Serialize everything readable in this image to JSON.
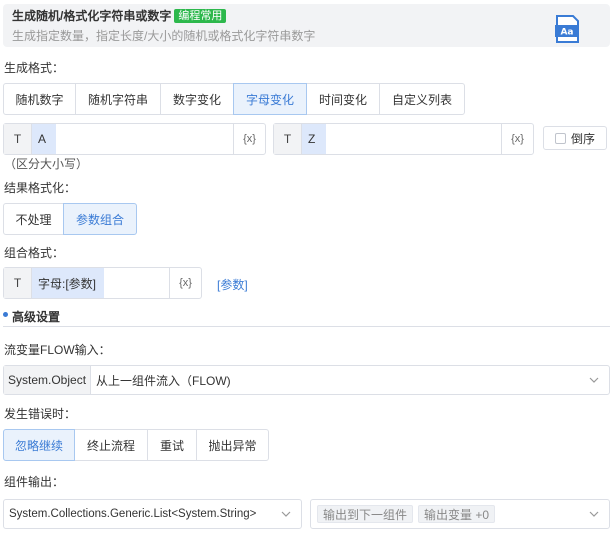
{
  "header": {
    "title": "生成随机/格式化字符串或数字",
    "badge": "编程常用",
    "subtitle": "生成指定数量，指定长度/大小的随机或格式化字符串数字",
    "icon_text": "Aa",
    "icon_color": "#3a7bd5"
  },
  "format": {
    "label": "生成格式：",
    "tabs": [
      {
        "label": "随机数字"
      },
      {
        "label": "随机字符串"
      },
      {
        "label": "数字变化"
      },
      {
        "label": "字母变化"
      },
      {
        "label": "时间变化"
      },
      {
        "label": "自定义列表"
      }
    ],
    "active_tab": "字母变化",
    "start": {
      "prefix": "T",
      "value": "A",
      "var": "{x}"
    },
    "end": {
      "prefix": "T",
      "value": "Z",
      "var": "{x}"
    },
    "reverse_label": "倒序",
    "case_note": "（区分大小写）"
  },
  "result_format": {
    "label": "结果格式化：",
    "options": [
      {
        "label": "不处理"
      },
      {
        "label": "参数组合"
      }
    ],
    "active": "参数组合"
  },
  "combo": {
    "label": "组合格式：",
    "prefix": "T",
    "value": "字母:[参数]",
    "var": "{x}",
    "link": "[参数]"
  },
  "advanced": {
    "title": "高级设置"
  },
  "flow": {
    "label": "流变量FLOW输入：",
    "type": "System.Object",
    "value": "从上一组件流入（FLOW)"
  },
  "error": {
    "label": "发生错误时：",
    "options": [
      {
        "label": "忽略继续"
      },
      {
        "label": "终止流程"
      },
      {
        "label": "重试"
      },
      {
        "label": "抛出异常"
      }
    ],
    "active": "忽略继续"
  },
  "output": {
    "label": "组件输出：",
    "type": "System.Collections.Generic.List<System.String>",
    "tags": [
      "输出到下一组件",
      "输出变量 +0"
    ]
  },
  "colors": {
    "accent": "#3a7bd5",
    "badge": "#2db84c",
    "active_bg": "#eaf2fc"
  }
}
